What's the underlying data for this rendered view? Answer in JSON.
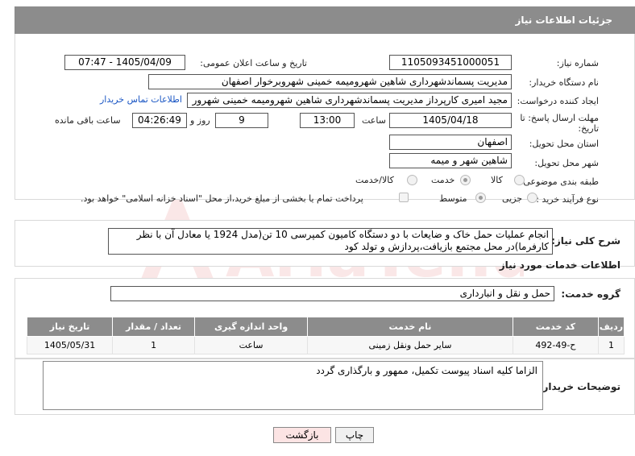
{
  "header": {
    "title": "جزئیات اطلاعات نیاز"
  },
  "fields": {
    "need_number_label": "شماره نیاز:",
    "need_number": "1105093451000051",
    "announce_label": "تاریخ و ساعت اعلان عمومی:",
    "announce_value": "1405/04/09 - 07:47",
    "buyer_label": "نام دستگاه خریدار:",
    "buyer_value": "مدیریت پسماندشهرداری شاهین شهرومیمه خمینی شهروبرخوار اصفهان",
    "creator_label": "ایجاد کننده درخواست:",
    "creator_value": "مجید امیری کارپرداز مدیریت پسماندشهرداری شاهین شهرومیمه خمینی شهرور",
    "contact_link": "اطلاعات تماس خریدار",
    "deadline_label_1": "مهلت ارسال پاسخ: تا",
    "deadline_label_2": "تاریخ:",
    "deadline_date": "1405/04/18",
    "time_label": "ساعت",
    "deadline_time": "13:00",
    "days_value": "9",
    "days_label": "روز و",
    "remaining_value": "04:26:49",
    "remaining_label": "ساعت باقی مانده",
    "province_label": "استان محل تحویل:",
    "province_value": "اصفهان",
    "city_label": "شهر محل تحویل:",
    "city_value": "شاهین شهر و میمه",
    "category_label": "طبقه بندی موضوعی:",
    "category_options": [
      "کالا",
      "خدمت",
      "کالا/خدمت"
    ],
    "category_selected": "خدمت",
    "process_label": "نوع فرآیند خرید :",
    "process_options": [
      "جزیی",
      "متوسط"
    ],
    "process_selected": "متوسط",
    "process_note": "پرداخت تمام یا بخشی از مبلغ خرید،از محل \"اسناد خزانه اسلامی\" خواهد بود."
  },
  "summary": {
    "label": "شرح کلی نیاز:",
    "text": "انجام عملیات حمل خاک و ضایعات با دو دستگاه کامیون کمپرسی 10 تن(مدل 1924 یا معادل آن با نظر کارفرما)در محل مجتمع بازیافت،پردازش و تولد کود"
  },
  "services": {
    "section_title": "اطلاعات خدمات مورد نیاز",
    "group_label": "گروه خدمت:",
    "group_value": "حمل و نقل و انبارداری",
    "columns": [
      "ردیف",
      "کد خدمت",
      "نام خدمت",
      "واحد اندازه گیری",
      "تعداد / مقدار",
      "تاریخ نیاز"
    ],
    "rows": [
      [
        "1",
        "ح-49-492",
        "سایر حمل ونقل زمینی",
        "ساعت",
        "1",
        "1405/05/31"
      ]
    ]
  },
  "buyer_notes": {
    "label": "توضیحات خریدار:",
    "text": "الزاما کلیه اسناد پیوست تکمیل، ممهور و بارگذاری گردد"
  },
  "buttons": {
    "print": "چاپ",
    "back": "بازگشت"
  },
  "watermark": {
    "text": "AriaTender.net"
  },
  "colors": {
    "header_bg": "#8c8c8c",
    "link": "#1a56c4",
    "back_btn_bg": "#fce4e4"
  }
}
